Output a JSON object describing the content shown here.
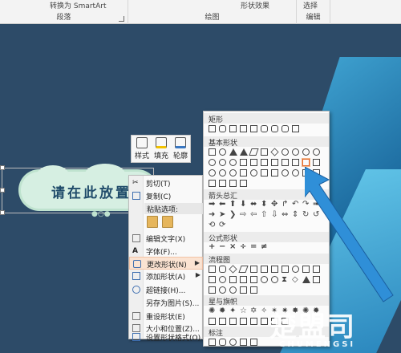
{
  "ribbon": {
    "smartart_label": "转换为 SmartArt",
    "paragraph_group": "段落",
    "drawing_group": "绘图",
    "shape_effects_label": "形状效果",
    "select_label": "选择",
    "edit_group": "编辑"
  },
  "slide": {
    "shape_text": "请在此放置"
  },
  "minibar": {
    "style_label": "样式",
    "fill_label": "填充",
    "outline_label": "轮廓"
  },
  "context_menu": {
    "items": [
      {
        "label": "剪切(T)",
        "icon": "scissors-icon"
      },
      {
        "label": "复制(C)",
        "icon": "copy-icon"
      },
      {
        "label": "编辑文字(X)",
        "icon": "edit-text-icon"
      },
      {
        "label": "字体(F)...",
        "icon": "font-icon"
      },
      {
        "label": "更改形状(N)",
        "icon": "change-shape-icon",
        "submenu": true
      },
      {
        "label": "添加形状(A)",
        "icon": "add-shape-icon",
        "submenu": true
      },
      {
        "label": "超链接(H)...",
        "icon": "hyperlink-icon"
      },
      {
        "label": "另存为图片(S)...",
        "icon": ""
      },
      {
        "label": "重设形状(E)",
        "icon": "reset-shape-icon"
      },
      {
        "label": "大小和位置(Z)...",
        "icon": "size-position-icon"
      },
      {
        "label": "设置形状格式(O)...",
        "icon": "format-shape-icon"
      }
    ],
    "paste_options_label": "粘贴选项:"
  },
  "gallery": {
    "categories": [
      "矩形",
      "基本形状",
      "箭头总汇",
      "公式形状",
      "流程图",
      "星与旗帜",
      "标注"
    ]
  },
  "colors": {
    "slide_background": "#2d4b68",
    "highlight": "#fbe3d2",
    "arrow": "#2f8fd8"
  },
  "watermark": {
    "main": "楚盟司",
    "sub": "CHUMENGSI"
  }
}
